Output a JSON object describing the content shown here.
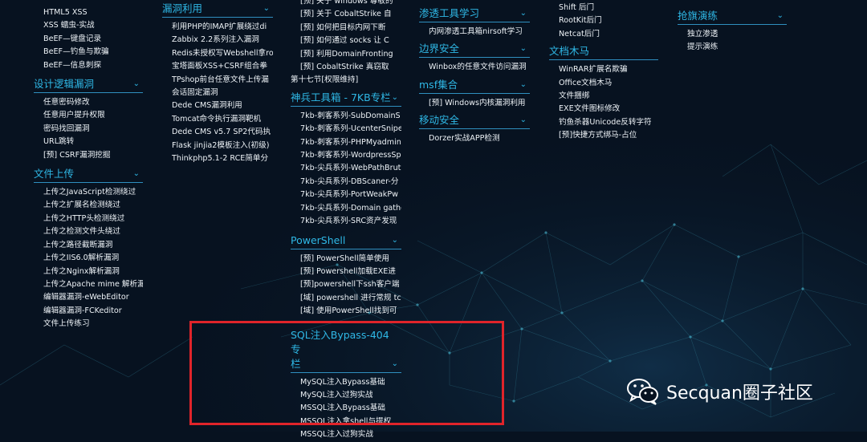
{
  "col1": {
    "top_items": [
      "HTML5 XSS",
      "XSS 蠕虫-实战",
      "BeEF—键盘记录",
      "BeEF—钓鱼与欺骗",
      "BeEF—信息刺探"
    ],
    "sections": [
      {
        "title": "设计逻辑漏洞",
        "items": [
          "任意密码修改",
          "任意用户提升权限",
          "密码找回漏洞",
          "URL跳转",
          "[预] CSRF漏洞挖掘"
        ]
      },
      {
        "title": "文件上传",
        "items": [
          "上传之JavaScript检测绕过",
          "上传之扩展名检测绕过",
          "上传之HTTP头检测绕过",
          "上传之检测文件头绕过",
          "上传之路径截断漏洞",
          "上传之IIS6.0解析漏洞",
          "上传之Nginx解析漏洞",
          "上传之Apache mime 解析漏",
          "编辑器漏洞-eWebEditor",
          "编辑器漏洞-FCKeditor",
          "文件上传练习"
        ]
      }
    ]
  },
  "col2": {
    "sections": [
      {
        "title": "漏洞利用",
        "items": [
          "利用PHP的IMAP扩展绕过di",
          "Zabbix 2.2系列注入漏洞",
          "Redis未授权写Webshell拿ro",
          "宝塔面板XSS+CSRF组合拳",
          "TPshop前台任意文件上传漏",
          "会话固定漏洞",
          "Dede CMS漏洞利用",
          "Tomcat命令执行漏洞靶机",
          "Dede CMS v5.7 SP2代码执",
          "Flask jinjia2模板注入(初级)",
          "Thinkphp5.1-2 RCE简单分"
        ]
      }
    ]
  },
  "col3": {
    "top_items": [
      "[预] 关于 windows 尊敬的",
      "[预] 关于 CobaltStrike 自",
      "[预] 如何把目标内网下断",
      "[预] 如何通过 socks 让 C",
      "[预] 利用DomainFronting",
      "[预] CobaltStrike 真窃取",
      "第十七节[权限维持]"
    ],
    "sections": [
      {
        "title": "神兵工具箱 - 7KB专栏",
        "items": [
          "7kb-刺客系列-SubDomainS",
          "7kb-刺客系列-UcenterSnipe",
          "7kb-刺客系列-PHPMyadmin",
          "7kb-刺客系列-WordpressSpi",
          "7kb-尖兵系列-WebPathBrut",
          "7kb-尖兵系列-DBScaner-分",
          "7kb-尖兵系列-PortWeakPw",
          "7kb-尖兵系列-Domain gathe",
          "7kb-尖兵系列-SRC资产发现"
        ]
      },
      {
        "title": "PowerShell",
        "items": [
          "[预] PowerShell简单使用",
          "[预] Powershell加载EXE进",
          "[预]powershell下ssh客户端",
          "[域] powershell 进行常规 tcp",
          "[域] 使用PowerShell找到可"
        ]
      },
      {
        "title_line1": "SQL注入Bypass-404专",
        "title_line2": "栏",
        "items": [
          "MySQL注入Bypass基础",
          "MySQL注入过狗实战",
          "MSSQL注入Bypass基础",
          "MSSQL注入拿shell与提权",
          "MSSQL注入过狗实战"
        ]
      }
    ]
  },
  "col4": {
    "sections": [
      {
        "title": "渗透工具学习",
        "items": [
          "内网渗透工具箱nirsoft学习"
        ]
      },
      {
        "title": "边界安全",
        "items": [
          "Winbox的任意文件访问漏洞"
        ]
      },
      {
        "title": "msf集合",
        "items": [
          "[预] Windows内核漏洞利用"
        ]
      },
      {
        "title": "移动安全",
        "items": [
          "Dorzer实战APP检测"
        ]
      }
    ]
  },
  "col5": {
    "top_items": [
      "Shift 后门",
      "RootKit后门",
      "Netcat后门"
    ],
    "sections": [
      {
        "title": "文档木马",
        "items": [
          "WinRAR扩展名欺骗",
          "Office文档木马",
          "文件捆绑",
          "EXE文件图标修改",
          "钓鱼杀器Unicode反转字符",
          "[预]快捷方式绑马-占位"
        ]
      }
    ]
  },
  "col6": {
    "sections": [
      {
        "title": "抢旗演练",
        "items": [
          "独立渗透",
          "提示演练"
        ]
      }
    ]
  },
  "chevron_glyph": "⌄",
  "watermark": {
    "text": "Secquan圈子社区",
    "icon": "wechat-icon"
  },
  "colors": {
    "background": "#071220",
    "accent": "#2fb8e6",
    "highlight_box": "#e0242a"
  }
}
